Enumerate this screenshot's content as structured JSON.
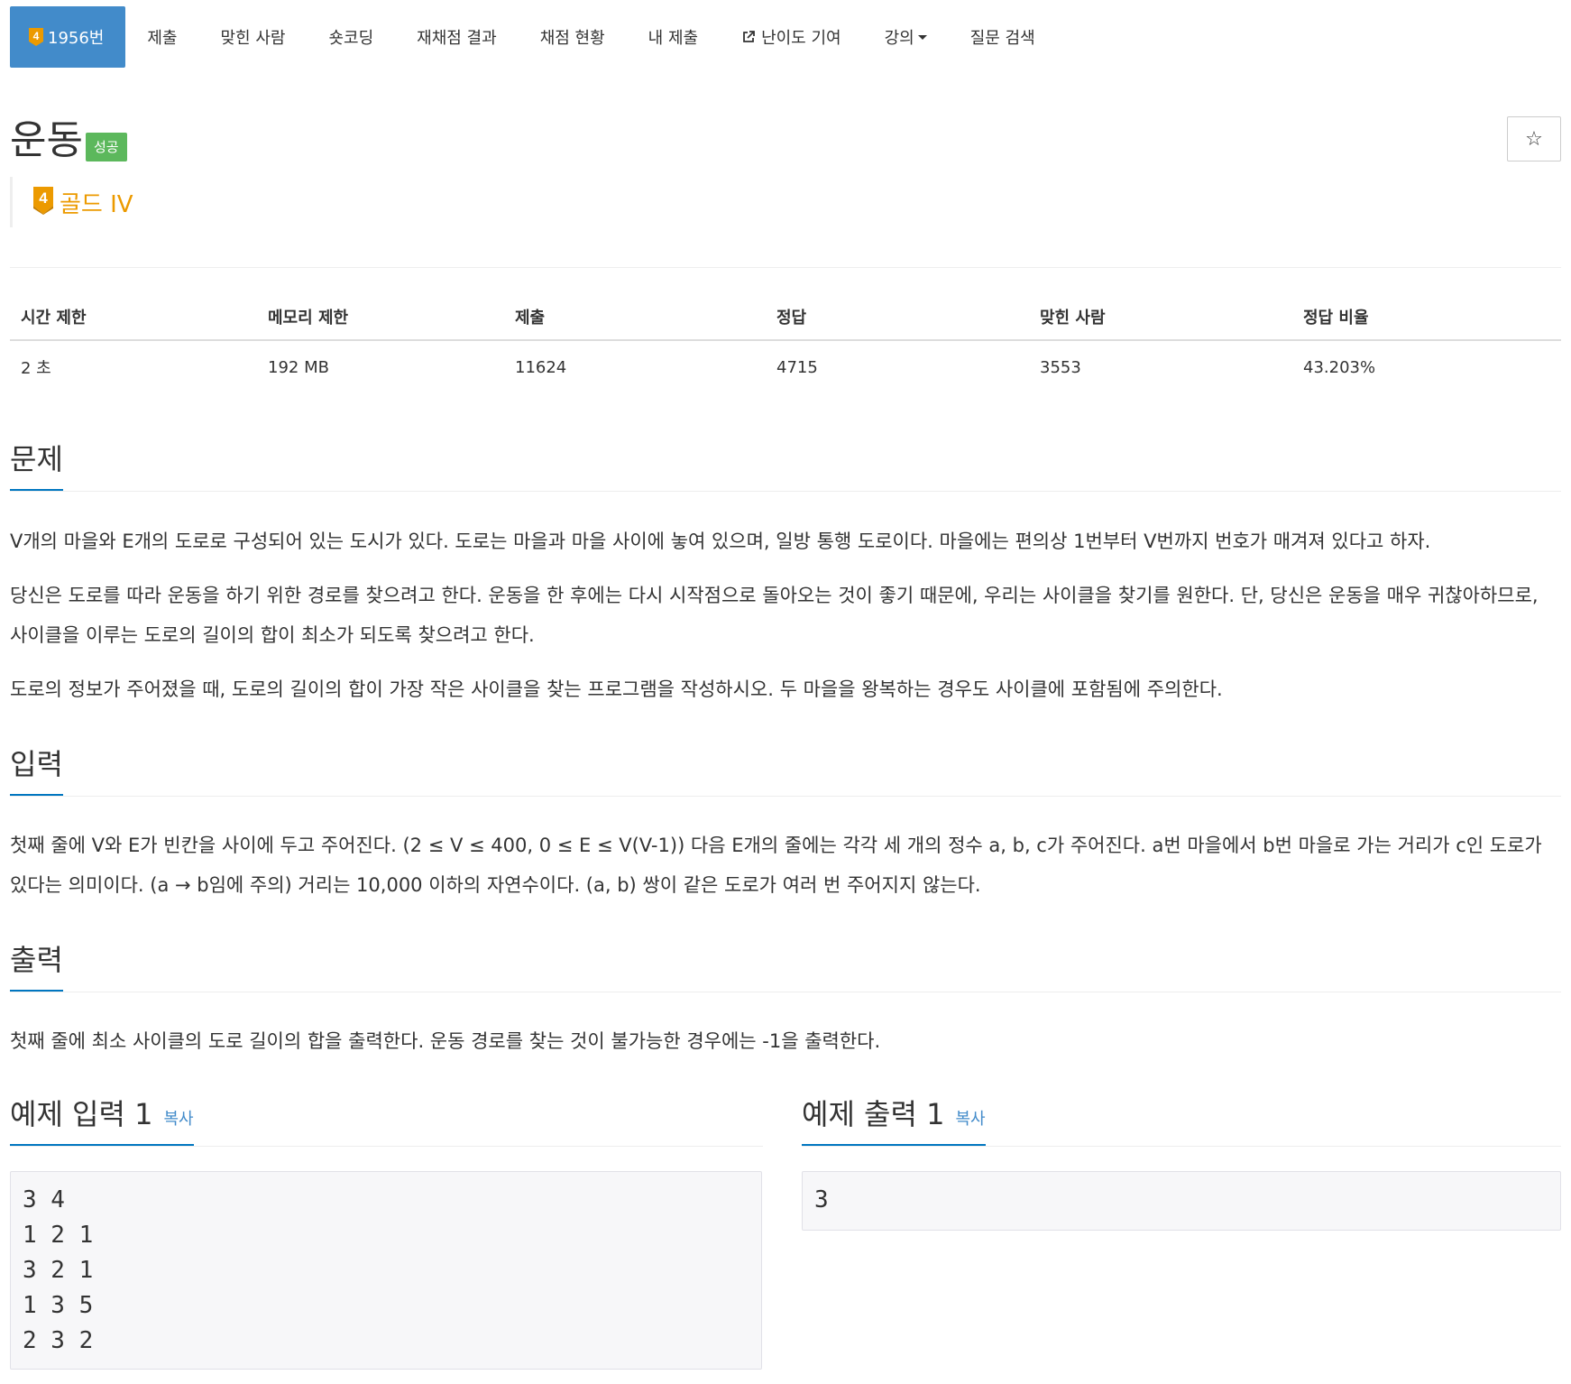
{
  "nav": {
    "problem_number": "1956번",
    "tier_badge_number": "4",
    "items": [
      "제출",
      "맞힌 사람",
      "숏코딩",
      "재채점 결과",
      "채점 현황",
      "내 제출",
      "난이도 기여",
      "강의",
      "질문 검색"
    ]
  },
  "title": "운동",
  "status_badge": "성공",
  "star_icon": "☆",
  "tier": {
    "number": "4",
    "label": "골드 IV",
    "color": "#ec9a00"
  },
  "info": {
    "headers": [
      "시간 제한",
      "메모리 제한",
      "제출",
      "정답",
      "맞힌 사람",
      "정답 비율"
    ],
    "values": [
      "2 초",
      "192 MB",
      "11624",
      "4715",
      "3553",
      "43.203%"
    ]
  },
  "sections": {
    "problem": {
      "heading": "문제",
      "paragraphs": [
        "V개의 마을와 E개의 도로로 구성되어 있는 도시가 있다. 도로는 마을과 마을 사이에 놓여 있으며, 일방 통행 도로이다. 마을에는 편의상 1번부터 V번까지 번호가 매겨져 있다고 하자.",
        "당신은 도로를 따라 운동을 하기 위한 경로를 찾으려고 한다. 운동을 한 후에는 다시 시작점으로 돌아오는 것이 좋기 때문에, 우리는 사이클을 찾기를 원한다. 단, 당신은 운동을 매우 귀찮아하므로, 사이클을 이루는 도로의 길이의 합이 최소가 되도록 찾으려고 한다.",
        "도로의 정보가 주어졌을 때, 도로의 길이의 합이 가장 작은 사이클을 찾는 프로그램을 작성하시오. 두 마을을 왕복하는 경우도 사이클에 포함됨에 주의한다."
      ]
    },
    "input": {
      "heading": "입력",
      "paragraph": "첫째 줄에 V와 E가 빈칸을 사이에 두고 주어진다. (2 ≤ V ≤ 400, 0 ≤ E ≤ V(V-1)) 다음 E개의 줄에는 각각 세 개의 정수 a, b, c가 주어진다. a번 마을에서 b번 마을로 가는 거리가 c인 도로가 있다는 의미이다. (a → b임에 주의) 거리는 10,000 이하의 자연수이다. (a, b) 쌍이 같은 도로가 여러 번 주어지지 않는다."
    },
    "output": {
      "heading": "출력",
      "paragraph": "첫째 줄에 최소 사이클의 도로 길이의 합을 출력한다. 운동 경로를 찾는 것이 불가능한 경우에는 -1을 출력한다."
    }
  },
  "samples": {
    "input": {
      "heading": "예제 입력 1",
      "copy_label": "복사",
      "content": "3 4\n1 2 1\n3 2 1\n1 3 5\n2 3 2"
    },
    "output": {
      "heading": "예제 출력 1",
      "copy_label": "복사",
      "content": "3"
    }
  },
  "colors": {
    "nav_active": "#428bca",
    "success": "#5cb85c",
    "tier_gold": "#ec9a00",
    "heading_underline": "#0076c0"
  }
}
